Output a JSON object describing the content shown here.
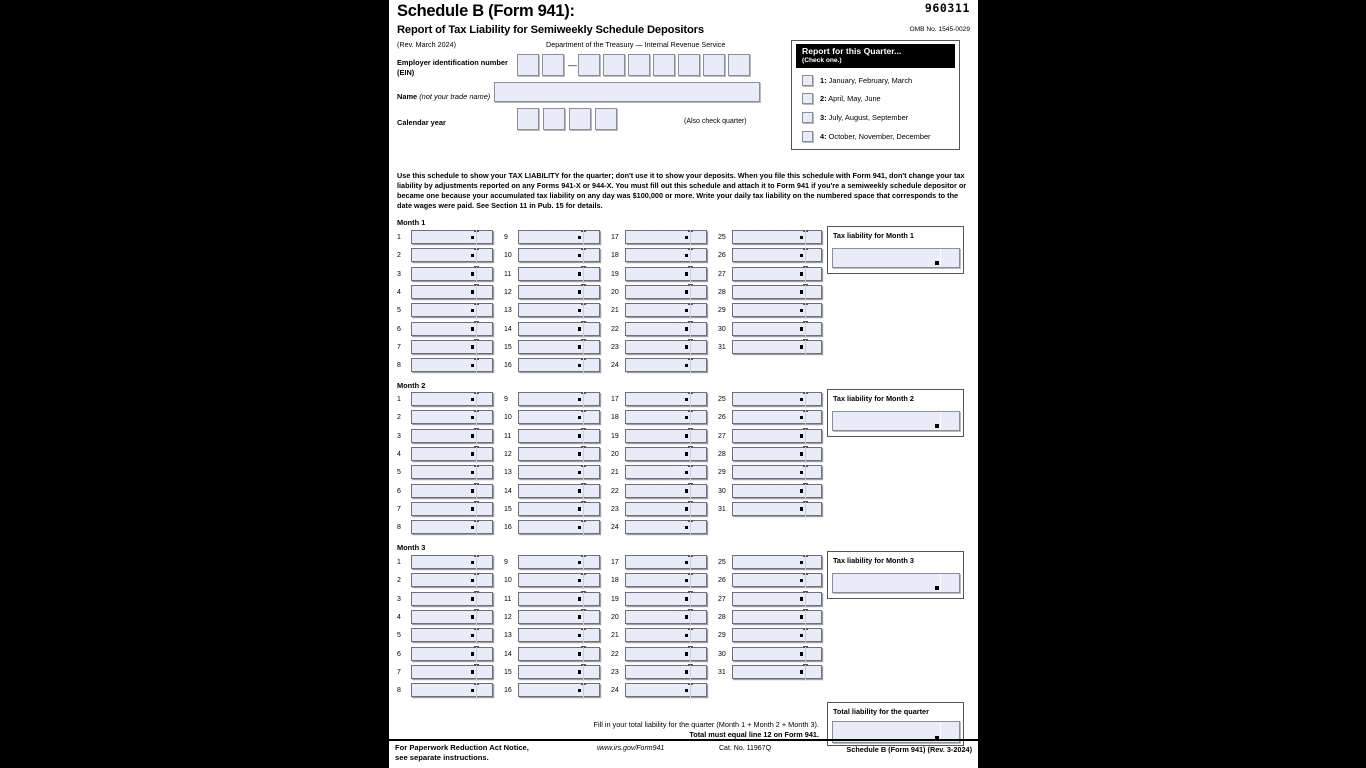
{
  "form": {
    "title": "Schedule B (Form 941):",
    "subtitle": "Report of Tax Liability for Semiweekly Schedule Depositors",
    "revision": "(Rev. March 2024)",
    "agency": "Department of the Treasury — Internal Revenue Service",
    "form_number": "960311",
    "omb": "OMB No. 1545-0029"
  },
  "fields": {
    "ein_label_line1": "Employer identification number",
    "ein_label_line2": "(EIN)",
    "ein_separator": "—",
    "ein_value": "",
    "name_label": "Name",
    "name_hint": "(not your trade name)",
    "name_value": "",
    "calendar_year_label": "Calendar year",
    "calendar_year_value": "",
    "also_check_quarter": "(Also check quarter)"
  },
  "quarter": {
    "header": "Report for this Quarter...",
    "subheader": "(Check one.)",
    "options": [
      {
        "num": "1:",
        "label": "January, February, March",
        "checked": false
      },
      {
        "num": "2:",
        "label": "April, May, June",
        "checked": false
      },
      {
        "num": "3:",
        "label": "July, August, September",
        "checked": false
      },
      {
        "num": "4:",
        "label": "October, November, December",
        "checked": false
      }
    ]
  },
  "instructions": "Use this schedule to show your TAX LIABILITY for the quarter; don't use it to show your deposits. When you file this schedule with Form 941, don't change your tax liability by adjustments reported on any Forms 941-X or 944-X. You must fill out this schedule and attach it to Form 941 if you're a semiweekly schedule depositor or became one because your accumulated tax liability on any day was $100,000 or more. Write your daily tax liability on the numbered space that corresponds to the date wages were paid. See Section 11 in Pub. 15 for details.",
  "months": [
    {
      "label": "Month 1",
      "tax_liability_caption": "Tax liability for Month 1",
      "tax_liability_value": "",
      "columns": [
        {
          "days": [
            "1",
            "2",
            "3",
            "4",
            "5",
            "6",
            "7",
            "8"
          ],
          "values": [
            "",
            "",
            "",
            "",
            "",
            "",
            "",
            ""
          ]
        },
        {
          "days": [
            "9",
            "10",
            "11",
            "12",
            "13",
            "14",
            "15",
            "16"
          ],
          "values": [
            "",
            "",
            "",
            "",
            "",
            "",
            "",
            ""
          ]
        },
        {
          "days": [
            "17",
            "18",
            "19",
            "20",
            "21",
            "22",
            "23",
            "24"
          ],
          "values": [
            "",
            "",
            "",
            "",
            "",
            "",
            "",
            ""
          ]
        },
        {
          "days": [
            "25",
            "26",
            "27",
            "28",
            "29",
            "30",
            "31"
          ],
          "values": [
            "",
            "",
            "",
            "",
            "",
            "",
            ""
          ]
        }
      ]
    },
    {
      "label": "Month 2",
      "tax_liability_caption": "Tax liability for Month 2",
      "tax_liability_value": "",
      "columns": [
        {
          "days": [
            "1",
            "2",
            "3",
            "4",
            "5",
            "6",
            "7",
            "8"
          ],
          "values": [
            "",
            "",
            "",
            "",
            "",
            "",
            "",
            ""
          ]
        },
        {
          "days": [
            "9",
            "10",
            "11",
            "12",
            "13",
            "14",
            "15",
            "16"
          ],
          "values": [
            "",
            "",
            "",
            "",
            "",
            "",
            "",
            ""
          ]
        },
        {
          "days": [
            "17",
            "18",
            "19",
            "20",
            "21",
            "22",
            "23",
            "24"
          ],
          "values": [
            "",
            "",
            "",
            "",
            "",
            "",
            "",
            ""
          ]
        },
        {
          "days": [
            "25",
            "26",
            "27",
            "28",
            "29",
            "30",
            "31"
          ],
          "values": [
            "",
            "",
            "",
            "",
            "",
            "",
            ""
          ]
        }
      ]
    },
    {
      "label": "Month 3",
      "tax_liability_caption": "Tax liability for Month 3",
      "tax_liability_value": "",
      "columns": [
        {
          "days": [
            "1",
            "2",
            "3",
            "4",
            "5",
            "6",
            "7",
            "8"
          ],
          "values": [
            "",
            "",
            "",
            "",
            "",
            "",
            "",
            ""
          ]
        },
        {
          "days": [
            "9",
            "10",
            "11",
            "12",
            "13",
            "14",
            "15",
            "16"
          ],
          "values": [
            "",
            "",
            "",
            "",
            "",
            "",
            "",
            ""
          ]
        },
        {
          "days": [
            "17",
            "18",
            "19",
            "20",
            "21",
            "22",
            "23",
            "24"
          ],
          "values": [
            "",
            "",
            "",
            "",
            "",
            "",
            "",
            ""
          ]
        },
        {
          "days": [
            "25",
            "26",
            "27",
            "28",
            "29",
            "30",
            "31"
          ],
          "values": [
            "",
            "",
            "",
            "",
            "",
            "",
            ""
          ]
        }
      ]
    }
  ],
  "total": {
    "line1": "Fill in your total liability for the quarter (Month 1 + Month 2 + Month 3).",
    "line2": "Total must equal line 12 on Form 941.",
    "caption": "Total liability for the quarter",
    "value": ""
  },
  "footer": {
    "notice_line1": "For Paperwork Reduction Act Notice,",
    "notice_line2": "see separate instructions.",
    "url": "www.irs.gov/Form941",
    "cat_no": "Cat. No. 11967Q",
    "right": "Schedule B (Form 941) (Rev. 3-2024)"
  },
  "colors": {
    "field_fill": "#e9ecf8",
    "field_border": "#8d8d96",
    "page_bg": "#ffffff",
    "backdrop": "#000000",
    "header_bar": "#000000"
  }
}
